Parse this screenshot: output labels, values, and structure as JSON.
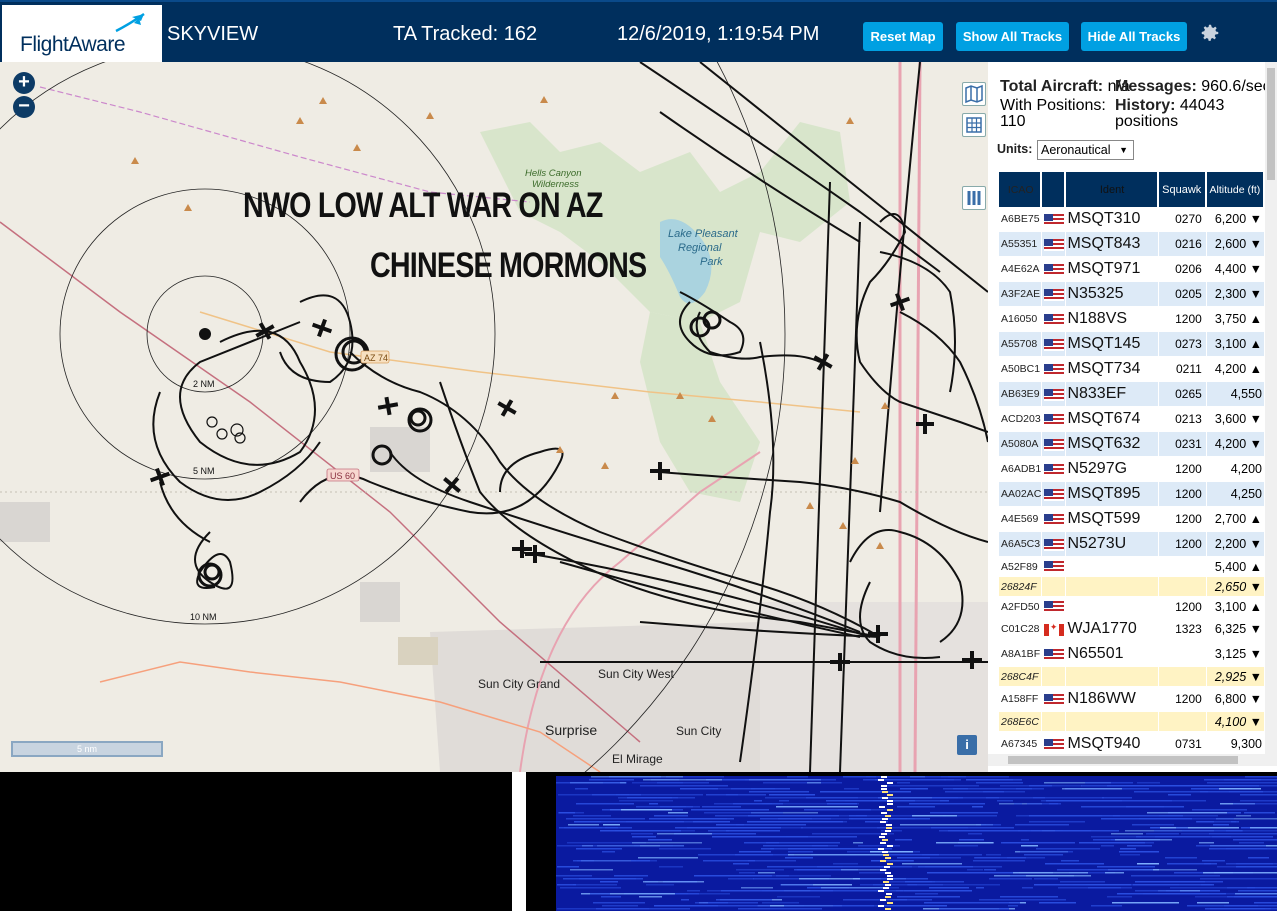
{
  "header": {
    "logo_text": "FlightAware",
    "app_name": "SKYVIEW",
    "tracked_label": "TA Tracked: 162",
    "datetime": "12/6/2019, 1:19:54 PM",
    "reset_map": "Reset Map",
    "show_all_tracks": "Show All Tracks",
    "hide_all_tracks": "Hide All Tracks"
  },
  "map": {
    "zoom_in": "+",
    "zoom_out": "−",
    "overlay_line1": "NWO LOW ALT WAR ON AZ",
    "overlay_line2": "CHINESE MORMONS",
    "scale_label": "5 nm",
    "info": "i",
    "labels": {
      "hells_canyon": "Hells Canyon",
      "wilderness": "Wilderness",
      "lake_pleasant": "Lake Pleasant",
      "regional": "Regional",
      "park": "Park",
      "ring_2nm": "2 NM",
      "ring_5nm": "5 NM",
      "ring_10nm": "10 NM",
      "sun_city_grand": "Sun City Grand",
      "sun_city_west": "Sun City West",
      "surprise": "Surprise",
      "sun_city": "Sun City",
      "el_mirage": "El Mirage",
      "us60": "US 60",
      "az74": "AZ 74"
    }
  },
  "panel": {
    "total_aircraft_label": "Total Aircraft:",
    "total_aircraft_value": "n/a",
    "messages_label": "Messages:",
    "messages_value": "960.6/sec",
    "with_positions_label": "With Positions:",
    "with_positions_value": "110",
    "history_label": "History:",
    "history_value": "44043",
    "history_unit": "positions",
    "units_label": "Units:",
    "units_value": "Aeronautical",
    "columns": [
      "ICAO",
      "",
      "Ident",
      "Squawk",
      "Altitude (ft)"
    ],
    "rows": [
      {
        "icao": "A6BE75",
        "flag": "us",
        "ident": "MSQT310",
        "squawk": "0270",
        "alt": "6,200 ▼",
        "style": "even"
      },
      {
        "icao": "A55351",
        "flag": "us",
        "ident": "MSQT843",
        "squawk": "0216",
        "alt": "2,600 ▼",
        "style": "odd"
      },
      {
        "icao": "A4E62A",
        "flag": "us",
        "ident": "MSQT971",
        "squawk": "0206",
        "alt": "4,400 ▼",
        "style": "even"
      },
      {
        "icao": "A3F2AE",
        "flag": "us",
        "ident": "N35325",
        "squawk": "0205",
        "alt": "2,300 ▼",
        "style": "odd"
      },
      {
        "icao": "A16050",
        "flag": "us",
        "ident": "N188VS",
        "squawk": "1200",
        "alt": "3,750 ▲",
        "style": "even"
      },
      {
        "icao": "A55708",
        "flag": "us",
        "ident": "MSQT145",
        "squawk": "0273",
        "alt": "3,100 ▲",
        "style": "odd"
      },
      {
        "icao": "A50BC1",
        "flag": "us",
        "ident": "MSQT734",
        "squawk": "0211",
        "alt": "4,200 ▲",
        "style": "even"
      },
      {
        "icao": "AB63E9",
        "flag": "us",
        "ident": "N833EF",
        "squawk": "0265",
        "alt": "4,550",
        "style": "odd"
      },
      {
        "icao": "ACD203",
        "flag": "us",
        "ident": "MSQT674",
        "squawk": "0213",
        "alt": "3,600 ▼",
        "style": "even"
      },
      {
        "icao": "A5080A",
        "flag": "us",
        "ident": "MSQT632",
        "squawk": "0231",
        "alt": "4,200 ▼",
        "style": "odd"
      },
      {
        "icao": "A6ADB1",
        "flag": "us",
        "ident": "N5297G",
        "squawk": "1200",
        "alt": "4,200",
        "style": "even"
      },
      {
        "icao": "AA02AC",
        "flag": "us",
        "ident": "MSQT895",
        "squawk": "1200",
        "alt": "4,250",
        "style": "odd"
      },
      {
        "icao": "A4E569",
        "flag": "us",
        "ident": "MSQT599",
        "squawk": "1200",
        "alt": "2,700 ▲",
        "style": "even"
      },
      {
        "icao": "A6A5C3",
        "flag": "us",
        "ident": "N5273U",
        "squawk": "1200",
        "alt": "2,200 ▼",
        "style": "odd"
      },
      {
        "icao": "A52F89",
        "flag": "us",
        "ident": "",
        "squawk": "",
        "alt": "5,400 ▲",
        "style": "even",
        "short": true
      },
      {
        "icao": "26824F",
        "flag": "",
        "ident": "",
        "squawk": "",
        "alt": "2,650 ▼",
        "style": "yellow",
        "short": true
      },
      {
        "icao": "A2FD50",
        "flag": "us",
        "ident": "",
        "squawk": "1200",
        "alt": "3,100 ▲",
        "style": "even",
        "short": true
      },
      {
        "icao": "C01C28",
        "flag": "ca",
        "ident": "WJA1770",
        "squawk": "1323",
        "alt": "6,325 ▼",
        "style": "even"
      },
      {
        "icao": "A8A1BF",
        "flag": "us",
        "ident": "N65501",
        "squawk": "",
        "alt": "3,125 ▼",
        "style": "even"
      },
      {
        "icao": "268C4F",
        "flag": "",
        "ident": "",
        "squawk": "",
        "alt": "2,925 ▼",
        "style": "yellow",
        "short": true
      },
      {
        "icao": "A158FF",
        "flag": "us",
        "ident": "N186WW",
        "squawk": "1200",
        "alt": "6,800 ▼",
        "style": "even"
      },
      {
        "icao": "268E6C",
        "flag": "",
        "ident": "",
        "squawk": "",
        "alt": "4,100 ▼",
        "style": "yellow",
        "short": true
      },
      {
        "icao": "A67345",
        "flag": "us",
        "ident": "MSQT940",
        "squawk": "0731",
        "alt": "9,300",
        "style": "even"
      }
    ]
  },
  "colors": {
    "header_bg": "#002f5d",
    "button_bg": "#00a0e2",
    "row_alt": "#ddeaf7",
    "row_highlight": "#fff3c4"
  }
}
